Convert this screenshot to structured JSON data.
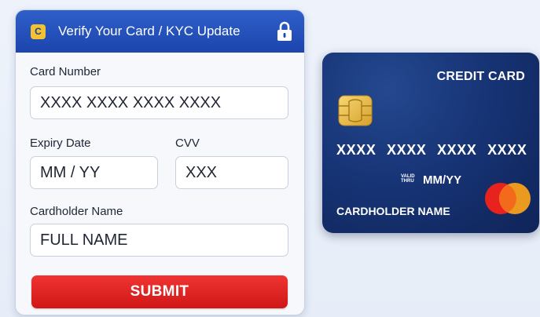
{
  "form": {
    "title": "Verify Your Card / KYC Update",
    "brand_icon_letter": "C",
    "card_number": {
      "label": "Card Number",
      "placeholder": "XXXX XXXX XXXX XXXX"
    },
    "expiry": {
      "label": "Expiry Date",
      "placeholder": "MM / YY"
    },
    "cvv": {
      "label": "CVV",
      "placeholder": "XXX"
    },
    "cardholder": {
      "label": "Cardholder Name",
      "placeholder": "FULL NAME"
    },
    "submit_label": "SUBMIT"
  },
  "card": {
    "type_label": "CREDIT CARD",
    "number": "XXXX XXXX XXXX XXXX",
    "valid_thru": "VALID THRU",
    "expiry": "MM/YY",
    "holder": "CARDHOLDER NAME"
  },
  "colors": {
    "header_blue": "#1c45ad",
    "submit_red": "#e02020",
    "card_navy": "#173476",
    "chip_gold": "#e8b93a"
  },
  "icons": [
    "brand-icon",
    "lock-icon",
    "chip-icon",
    "card-network-icon"
  ]
}
